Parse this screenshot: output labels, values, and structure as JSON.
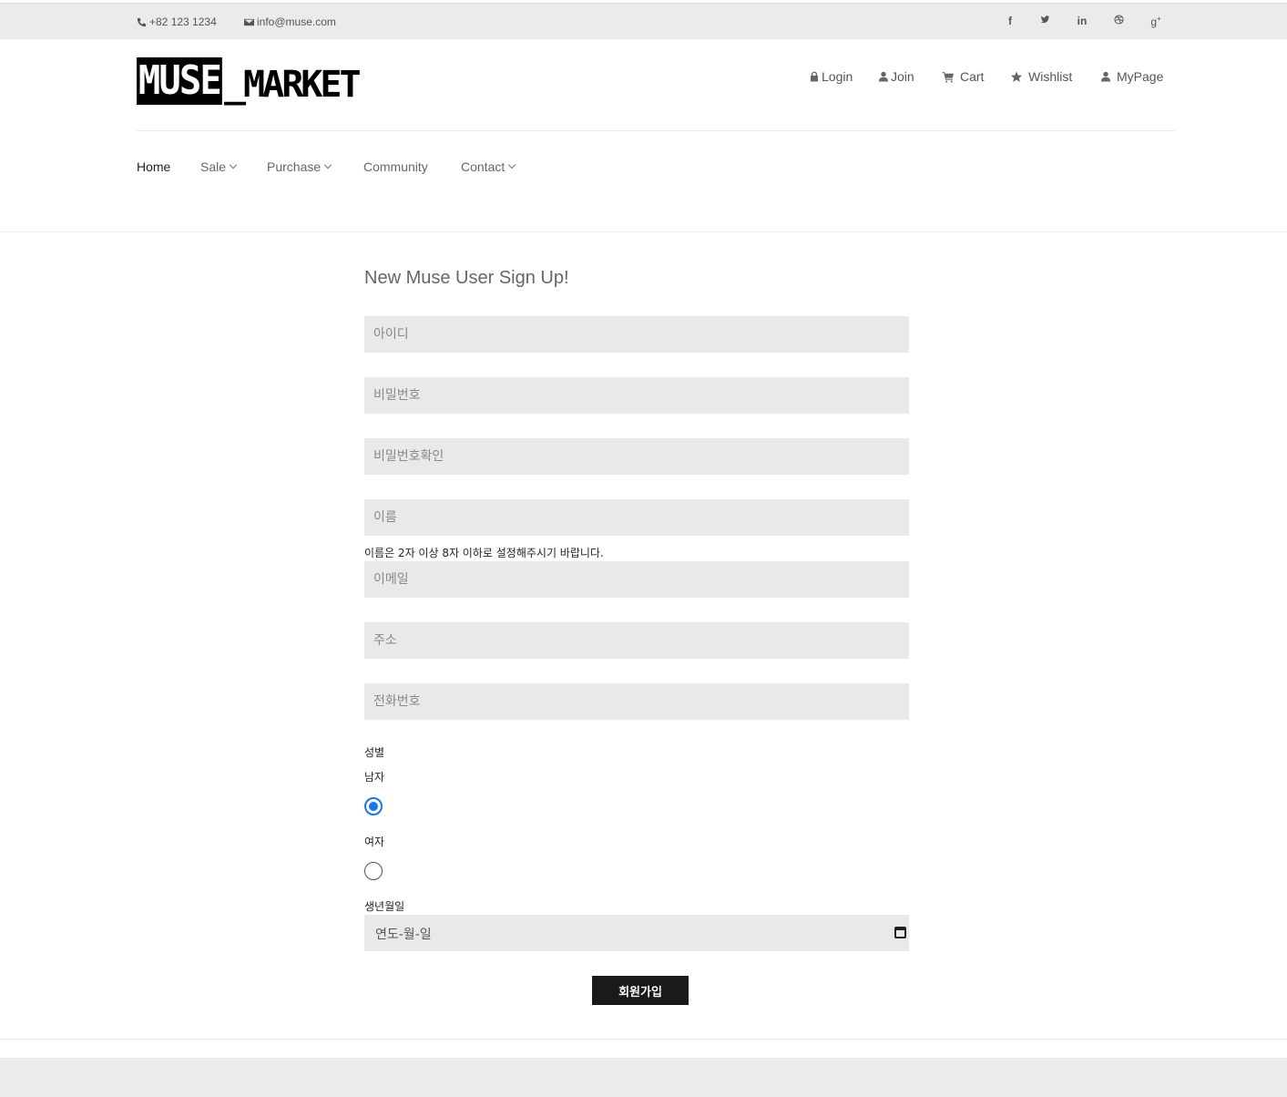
{
  "topbar": {
    "phone": "+82 123 1234",
    "email": "info@muse.com",
    "social": [
      "f",
      "t",
      "in",
      "d",
      "g+"
    ]
  },
  "logo": {
    "part1": "MUSE",
    "part2": "_MARKET"
  },
  "user_nav": {
    "login": "Login",
    "join": "Join",
    "cart": "Cart",
    "wishlist": "Wishlist",
    "mypage": "MyPage"
  },
  "main_nav": {
    "home": "Home",
    "sale": "Sale",
    "purchase": "Purchase",
    "community": "Community",
    "contact": "Contact"
  },
  "form": {
    "title": "New Muse User Sign Up!",
    "id_placeholder": "아이디",
    "password_placeholder": "비밀번호",
    "password_confirm_placeholder": "비밀번호확인",
    "name_placeholder": "이름",
    "name_hint": "이름은 2자 이상 8자 이하로 설정해주시기 바랍니다.",
    "email_placeholder": "이메일",
    "address_placeholder": "주소",
    "phone_placeholder": "전화번호",
    "gender_label": "성별",
    "male_label": "남자",
    "female_label": "여자",
    "selected_gender": "남자",
    "birth_label": "생년월일",
    "birth_placeholder": "연도-월-일",
    "submit_label": "회원가입"
  },
  "colors": {
    "field_bg": "#e9e9e9",
    "button_bg": "#1a1a1a",
    "radio_accent": "#1a73e8"
  }
}
